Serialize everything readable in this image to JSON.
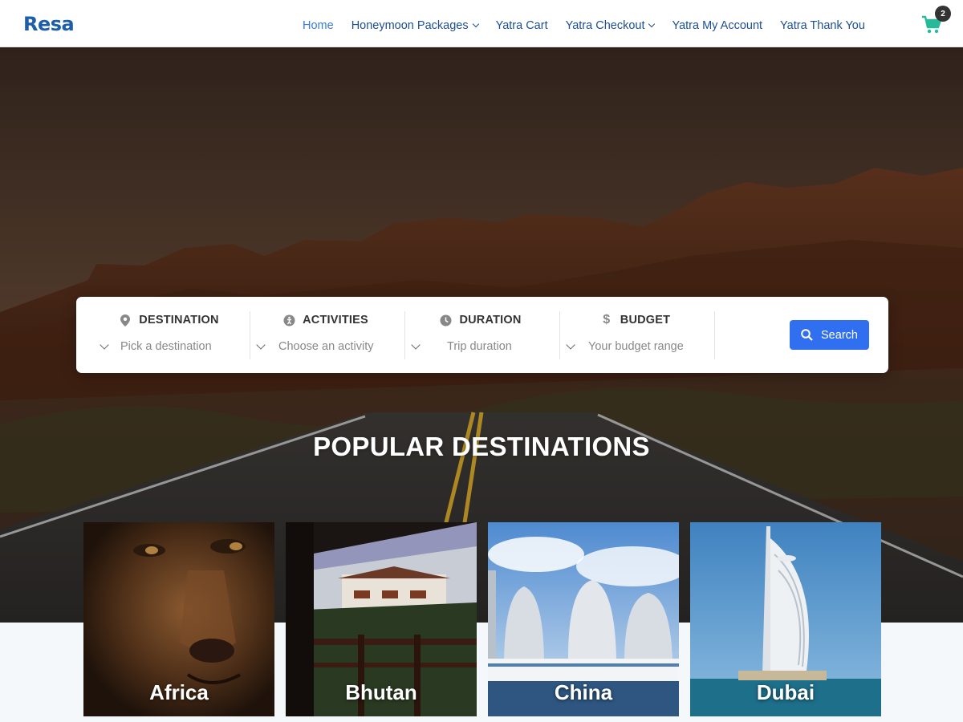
{
  "header": {
    "logo": "Resa",
    "nav": [
      {
        "label": "Home",
        "active": true,
        "dropdown": false
      },
      {
        "label": "Honeymoon Packages",
        "active": false,
        "dropdown": true
      },
      {
        "label": "Yatra Cart",
        "active": false,
        "dropdown": false
      },
      {
        "label": "Yatra Checkout",
        "active": false,
        "dropdown": true
      },
      {
        "label": "Yatra My Account",
        "active": false,
        "dropdown": false
      },
      {
        "label": "Yatra Thank You",
        "active": false,
        "dropdown": false
      }
    ],
    "cart_count": "2",
    "cart_icon": "shopping-cart-icon",
    "cart_color": "#26b99a"
  },
  "search": {
    "fields": [
      {
        "title": "DESTINATION",
        "icon": "map-pin-icon",
        "placeholder": "Pick a destination"
      },
      {
        "title": "ACTIVITIES",
        "icon": "activity-icon",
        "placeholder": "Choose an activity"
      },
      {
        "title": "DURATION",
        "icon": "clock-icon",
        "placeholder": "Trip duration"
      },
      {
        "title": "BUDGET",
        "icon": "dollar-icon",
        "placeholder": "Your budget range"
      }
    ],
    "button_label": "Search",
    "button_color": "#2f6ff0"
  },
  "section": {
    "title": "POPULAR DESTINATIONS"
  },
  "destinations": [
    {
      "name": "Africa"
    },
    {
      "name": "Bhutan"
    },
    {
      "name": "China"
    },
    {
      "name": "Dubai"
    }
  ],
  "colors": {
    "logo": "#1d5ea8",
    "nav_text": "#1d4f91",
    "nav_active": "#3a7bd5"
  }
}
